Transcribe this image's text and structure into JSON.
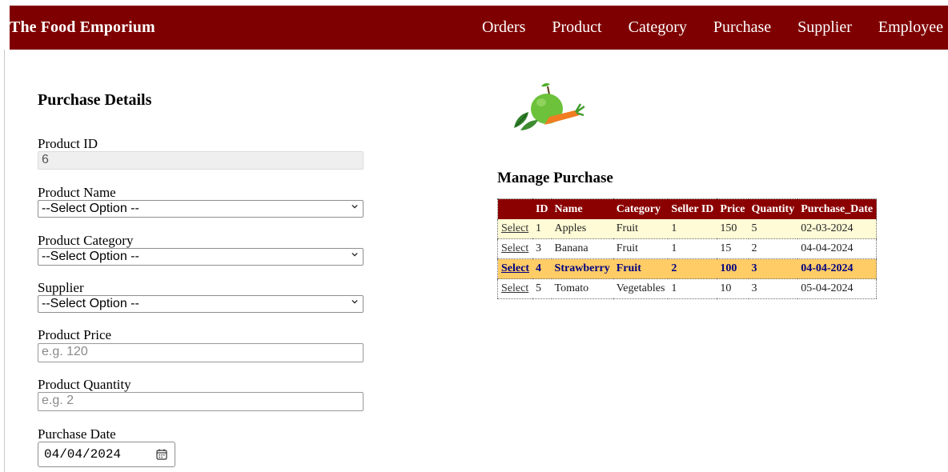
{
  "navbar": {
    "brand": "The Food Emporium",
    "links": [
      "Orders",
      "Product",
      "Category",
      "Purchase",
      "Supplier",
      "Employee"
    ]
  },
  "form": {
    "title": "Purchase Details",
    "product_id": {
      "label": "Product ID",
      "value": "6"
    },
    "product_name": {
      "label": "Product Name",
      "value": "--Select Option --"
    },
    "product_category": {
      "label": "Product Category",
      "value": "--Select Option --"
    },
    "supplier": {
      "label": "Supplier",
      "value": "--Select Option --"
    },
    "product_price": {
      "label": "Product Price",
      "placeholder": "e.g. 120"
    },
    "product_quantity": {
      "label": "Product Quantity",
      "placeholder": "e.g. 2"
    },
    "purchase_date": {
      "label": "Purchase Date",
      "value": "04/04/2024"
    }
  },
  "manage": {
    "title": "Manage Purchase",
    "columns": [
      "",
      "ID",
      "Name",
      "Category",
      "Seller ID",
      "Price",
      "Quantity",
      "Purchase_Date"
    ],
    "rows": [
      {
        "select": "Select",
        "id": "1",
        "name": "Apples",
        "category": "Fruit",
        "seller_id": "1",
        "price": "150",
        "quantity": "5",
        "date": "02-03-2024"
      },
      {
        "select": "Select",
        "id": "3",
        "name": "Banana",
        "category": "Fruit",
        "seller_id": "1",
        "price": "15",
        "quantity": "2",
        "date": "04-04-2024"
      },
      {
        "select": "Select",
        "id": "4",
        "name": "Strawberry",
        "category": "Fruit",
        "seller_id": "2",
        "price": "100",
        "quantity": "3",
        "date": "04-04-2024"
      },
      {
        "select": "Select",
        "id": "5",
        "name": "Tomato",
        "category": "Vegetables",
        "seller_id": "1",
        "price": "10",
        "quantity": "3",
        "date": "05-04-2024"
      }
    ],
    "selected_row_index": 2
  },
  "colors": {
    "navbar_bg": "#7f0000",
    "header_bg": "#8b0000",
    "row_alt_bg": "#fffbd6",
    "selected_row_bg": "#ffcc66",
    "selected_row_text": "#000080"
  },
  "icons": {
    "logo": "fruit-vegetable-logo-icon",
    "calendar": "calendar-icon",
    "dropdown": "chevron-down-icon"
  }
}
